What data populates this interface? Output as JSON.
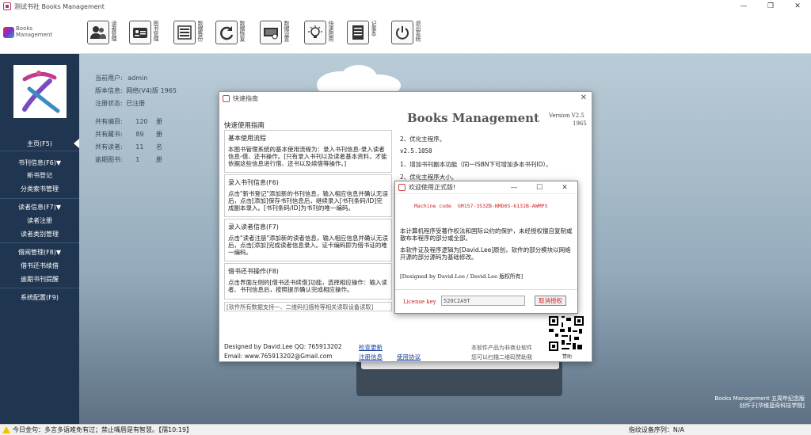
{
  "window": {
    "title": "测试书社 Books Management",
    "min_glyph": "—",
    "max_glyph": "❐",
    "close_glyph": "✕"
  },
  "logo": {
    "line1": "Books",
    "line2": "Management"
  },
  "toolbar": {
    "buttons": [
      {
        "label": "读者管理",
        "icon": "user-icon"
      },
      {
        "label": "图书管理",
        "icon": "id-card-icon"
      },
      {
        "label": "数据备份",
        "icon": "database-icon"
      },
      {
        "label": "数据恢复",
        "icon": "refresh-icon"
      },
      {
        "label": "数据设置",
        "icon": "settings-monitor-icon"
      },
      {
        "label": "快速指南",
        "icon": "lightbulb-icon"
      },
      {
        "label": "记事本",
        "icon": "notepad-icon"
      },
      {
        "label": "退出系统",
        "icon": "power-icon"
      }
    ]
  },
  "sidebar": {
    "home": "主页(F5)",
    "book_info": "书刊信息(F6)▼",
    "book_register": "新书登记",
    "category_manage": "分类索书管理",
    "reader_info": "读者信息(F7)▼",
    "reader_register": "读者注册",
    "reader_category": "读者类别管理",
    "borrow_manage": "借阅管理(F8)▼",
    "borrow_return": "借书还书续借",
    "overdue_remind": "逾期书刊提醒",
    "system_config": "系统配置(F9)"
  },
  "info": {
    "current_user_label": "当前用户:",
    "current_user": "admin",
    "version_label": "版本信息:",
    "version": "网络(V4)版 1965",
    "reg_label": "注册状态:",
    "reg_status": "已注册",
    "total_items_label": "共有编目:",
    "total_items": "120",
    "total_items_unit": "册",
    "total_books_label": "共有藏书:",
    "total_books": "89",
    "total_books_unit": "册",
    "total_readers_label": "共有读者:",
    "total_readers": "11",
    "total_readers_unit": "名",
    "overdue_label": "逾期图书:",
    "overdue": "1",
    "overdue_unit": "册"
  },
  "guide": {
    "title": "快速指南",
    "heading": "快速使用指南",
    "sections": [
      {
        "title": "基本使用流程",
        "body": "本图书管理系统的基本使用流程为：录入书刊信息-录入读者信息-借、还书操作。[只有录入书刊以及读者基本资料，才能依据这些信息进行借、还书以及续借等操作。]"
      },
      {
        "title": "录入书刊信息(F6)",
        "body": "点击\"新书登记\"添加新的书刊信息，输入相应信息并确认无误后，点击[添加]保存书刊信息后，继续录入[书刊条码/ID]完成副本录入。[书刊条码/ID]为书刊的唯一编码。"
      },
      {
        "title": "录入读者信息(F7)",
        "body": "点击\"读者注册\"添加新的读者信息，输入相应信息并确认无误后，点击[添加]完成读者信息录入。证卡编码即为借书证的唯一编码。"
      },
      {
        "title": "借书还书操作(F8)",
        "body": "点击界面左侧的[借书还书续借]功能，选择相应操作：输入读者、书刊信息后，按照提示确认完成相应操作。"
      }
    ],
    "support_note": "[软件所有数据支持一、二维码扫描枪等相关读取设备读取]",
    "app_name": "Books Management",
    "version_line1": "Version V2.5",
    "version_line2": "1965",
    "changelog": [
      "2、优化主程序。",
      "v2.5.1050",
      "1、增加书刊副本功能（同一ISBN下可增加多本书刊ID）。",
      "2、优化主程序大小。"
    ],
    "designed_by": "Designed by David.Lee  QQ: 765913202",
    "email": "Email:  www.765913202@Gmail.com",
    "check_update": "检查更新",
    "register_info": "注册信息",
    "usage_agreement": "使用协议",
    "disclaimer1": "本软件产品为非商业软件",
    "disclaimer2": "您可以扫描二维码赞助我",
    "qr_caption": "赞助"
  },
  "welcome": {
    "title": "欢迎使用正式版!",
    "machine_code_label": "Machine code",
    "machine_code": "GM157-3S3ZB-NMD65-6132B-AWMP5",
    "para1": "本计算机程序受著作权法和国际公约的保护，未经授权擅自复制或散布本程序的部分或全部。",
    "para2": "本软件证及程序逻辑为[David.Lee]原创，软件的部分模块以网络开源的部分源码为基础修改。",
    "signature": "[Designed by David.Lee / David.Lee 版权所有]",
    "license_label": "License key",
    "license_key": "520C2A9T",
    "cancel_button": "取消授权"
  },
  "credit": {
    "line1": "Books Management 五周年纪念版",
    "line2": "创作于[华维蓝奇科技学院]"
  },
  "status": {
    "message": "今日金句：多言多语难免有过；禁止嘴唇是有智慧。【孺10:19】",
    "device_label": "指纹设备序列：",
    "device_value": "N/A"
  },
  "colors": {
    "sidebar_bg": "#1f3550",
    "accent_red": "#d22020",
    "main_bg": "#a9bdca"
  }
}
